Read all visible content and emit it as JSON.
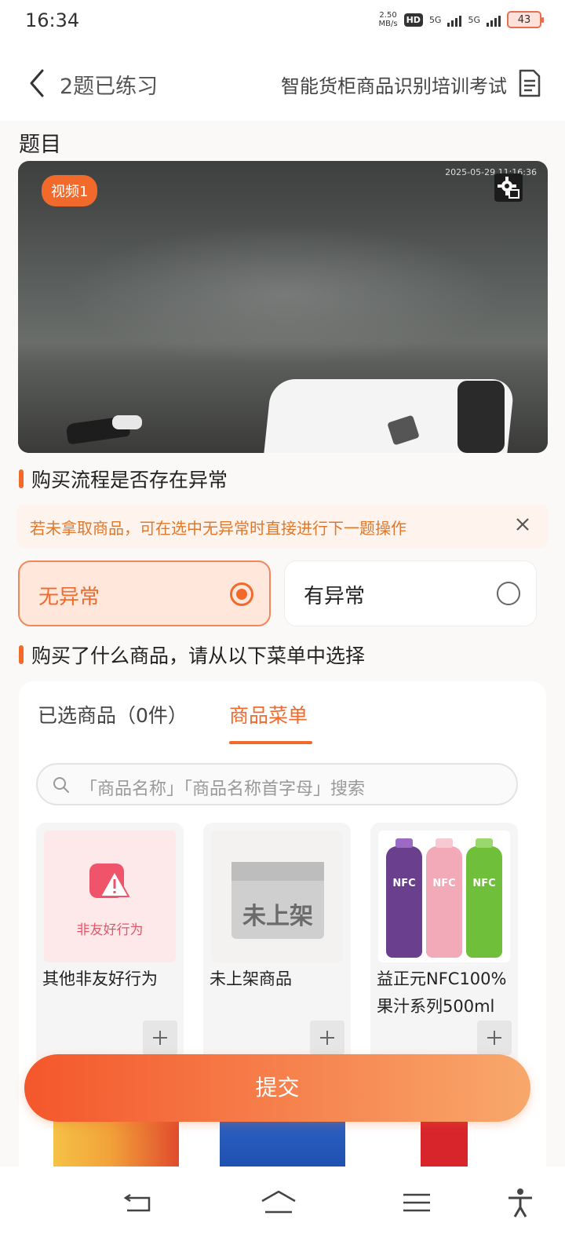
{
  "status_bar": {
    "time": "16:34",
    "net_speed": "2.50",
    "net_unit": "MB/s",
    "hd_label": "HD",
    "sim1": "5G",
    "sim2": "5G",
    "battery": "43"
  },
  "header": {
    "practiced": "2题已练习",
    "exam_title": "智能货柜商品识别培训考试"
  },
  "question": {
    "section_title": "题目",
    "video_badge": "视频1",
    "video_timestamp": "2025-05-29 11:16:36"
  },
  "anomaly": {
    "label": "购买流程是否存在异常",
    "notice": "若未拿取商品，可在选中无异常时直接进行下一题操作",
    "options": [
      {
        "label": "无异常",
        "selected": true
      },
      {
        "label": "有异常",
        "selected": false
      }
    ]
  },
  "goods": {
    "label": "购买了什么商品，请从以下菜单中选择",
    "tabs": [
      {
        "label": "已选商品（0件）",
        "active": false
      },
      {
        "label": "商品菜单",
        "active": true
      }
    ],
    "search_placeholder": "「商品名称」「商品名称首字母」搜索",
    "items": [
      {
        "name": "其他非友好行为",
        "thumb_text": "非友好行为",
        "icon": "warning-icon"
      },
      {
        "name": "未上架商品",
        "thumb_text": "未上架",
        "icon": "box-icon"
      },
      {
        "name": "益正元NFC100%果汁系列500ml",
        "thumb_text": "NFC",
        "icon": "juice-bottles"
      }
    ]
  },
  "submit_label": "提交",
  "colors": {
    "accent": "#f26a2b",
    "selected_bg": "#ffe7dc",
    "notice_bg": "#fff4ed",
    "notice_text": "#e0772a"
  }
}
